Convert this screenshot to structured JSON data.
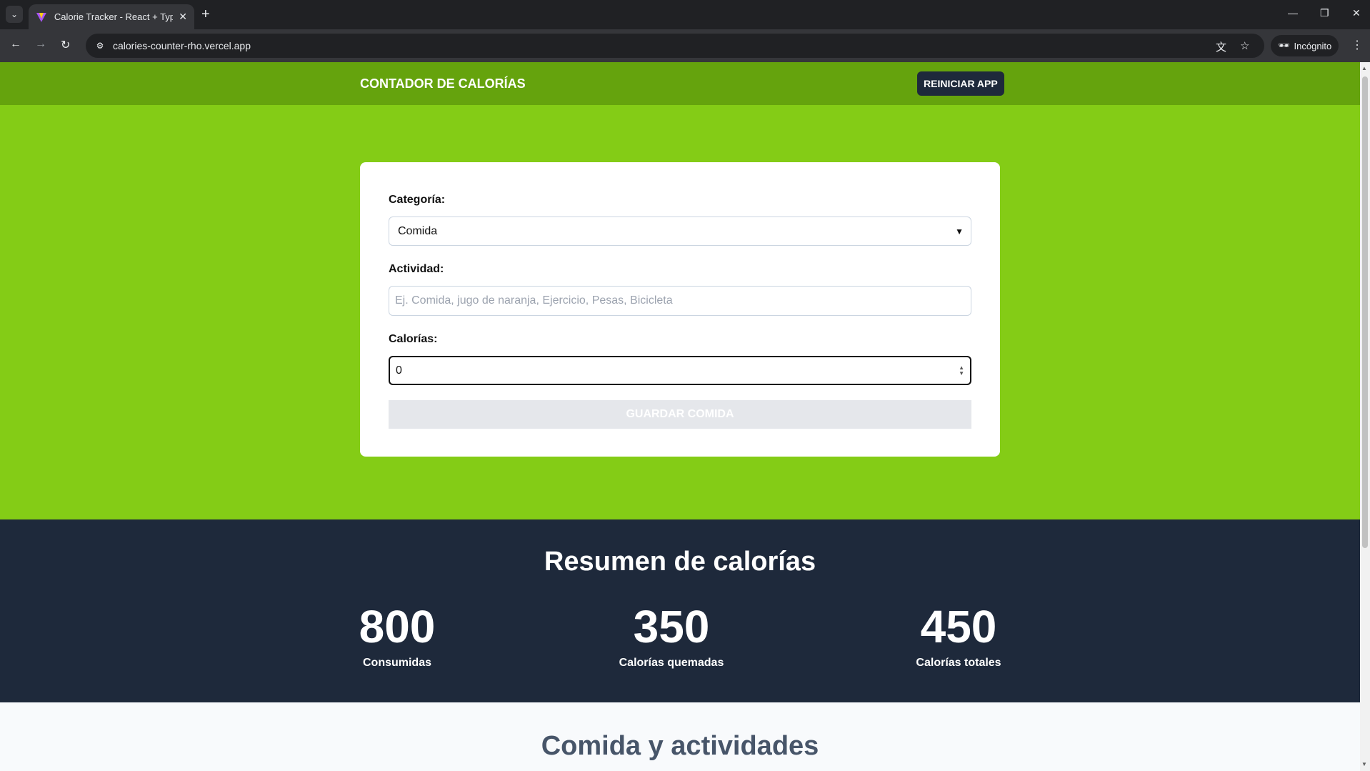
{
  "browser": {
    "tab_title": "Calorie Tracker - React + TypeScript",
    "url": "calories-counter-rho.vercel.app",
    "incognito_label": "Incógnito"
  },
  "header": {
    "title": "CONTADOR DE CALORÍAS",
    "reset_label": "REINICIAR APP"
  },
  "form": {
    "category_label": "Categoría:",
    "category_value": "Comida",
    "activity_label": "Actividad:",
    "activity_placeholder": "Ej. Comida, jugo de naranja, Ejercicio, Pesas, Bicicleta",
    "calories_label": "Calorías:",
    "calories_value": "0",
    "save_label": "GUARDAR COMIDA"
  },
  "summary": {
    "title": "Resumen de calorías",
    "stats": [
      {
        "value": "800",
        "label": "Consumidas"
      },
      {
        "value": "350",
        "label": "Calorías quemadas"
      },
      {
        "value": "450",
        "label": "Calorías totales"
      }
    ]
  },
  "activities": {
    "title": "Comida y actividades"
  },
  "colors": {
    "header_bg": "#65a30d",
    "form_bg": "#84cc16",
    "summary_bg": "#1e293b"
  }
}
